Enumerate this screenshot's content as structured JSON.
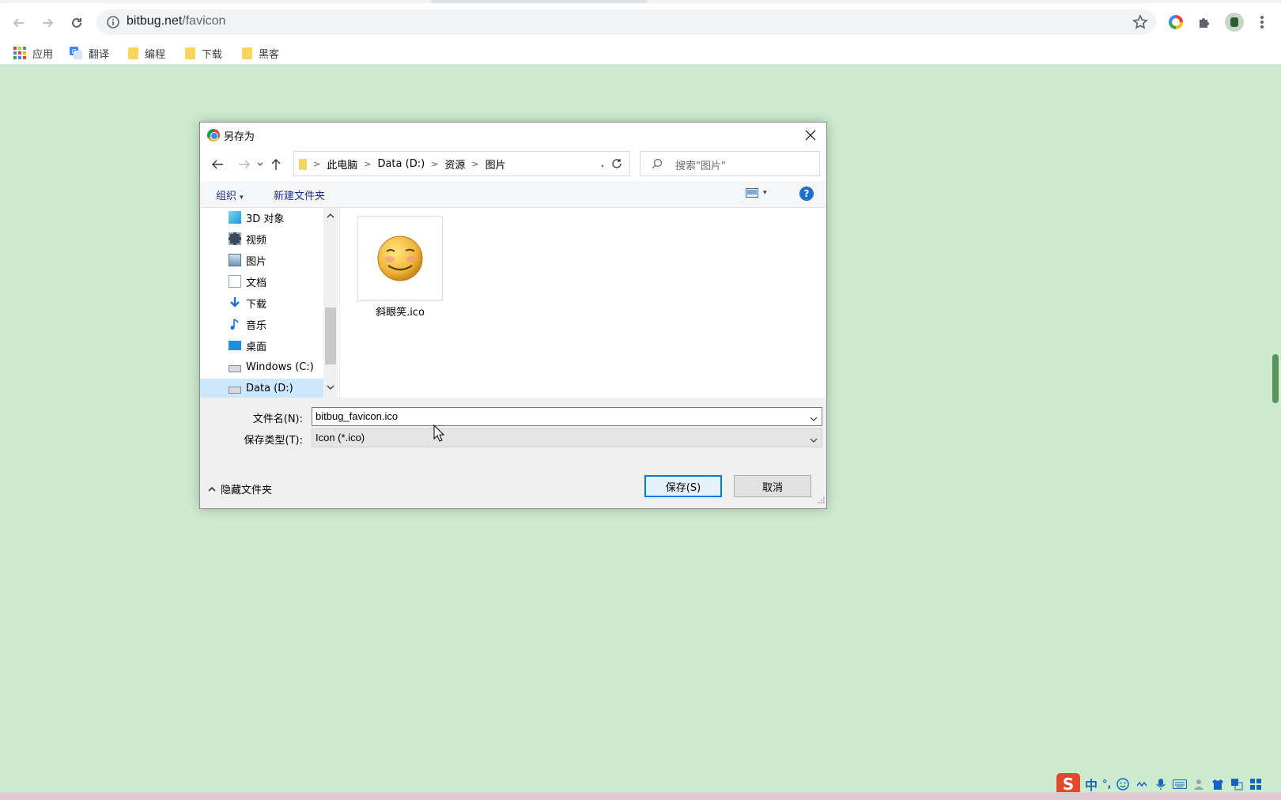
{
  "browser": {
    "url_host": "bitbug.net",
    "url_path": "/favicon",
    "bookmarks": [
      {
        "label": "应用",
        "icon": "apps-grid-icon"
      },
      {
        "label": "翻译",
        "icon": "translate-icon"
      },
      {
        "label": "编程",
        "icon": "folder-icon"
      },
      {
        "label": "下载",
        "icon": "folder-icon"
      },
      {
        "label": "黑客",
        "icon": "folder-icon"
      }
    ]
  },
  "dialog": {
    "title": "另存为",
    "breadcrumbs": [
      "此电脑",
      "Data (D:)",
      "资源",
      "图片"
    ],
    "search_placeholder": "搜索\"图片\"",
    "organize_label": "组织",
    "new_folder_label": "新建文件夹",
    "nav_items": [
      {
        "label": "3D 对象",
        "icon": "3d-objects-icon"
      },
      {
        "label": "视频",
        "icon": "videos-icon"
      },
      {
        "label": "图片",
        "icon": "pictures-icon"
      },
      {
        "label": "文档",
        "icon": "documents-icon"
      },
      {
        "label": "下载",
        "icon": "downloads-icon"
      },
      {
        "label": "音乐",
        "icon": "music-icon"
      },
      {
        "label": "桌面",
        "icon": "desktop-icon"
      },
      {
        "label": "Windows (C:)",
        "icon": "drive-icon"
      },
      {
        "label": "Data (D:)",
        "icon": "drive-icon",
        "selected": true
      }
    ],
    "files": [
      {
        "name": "斜眼笑.ico",
        "icon": "smiley-face-icon"
      }
    ],
    "filename_label": "文件名(N):",
    "filename_value": "bitbug_favicon.ico",
    "filetype_label": "保存类型(T):",
    "filetype_value": "Icon (*.ico)",
    "hide_folders_label": "隐藏文件夹",
    "save_label": "保存(S)",
    "cancel_label": "取消"
  },
  "ime": {
    "logo": "S",
    "mode": "中",
    "punct": "°,"
  },
  "colors": {
    "page_bg": "#cdebcf",
    "accent": "#0078d7",
    "selection": "#cce8ff"
  }
}
